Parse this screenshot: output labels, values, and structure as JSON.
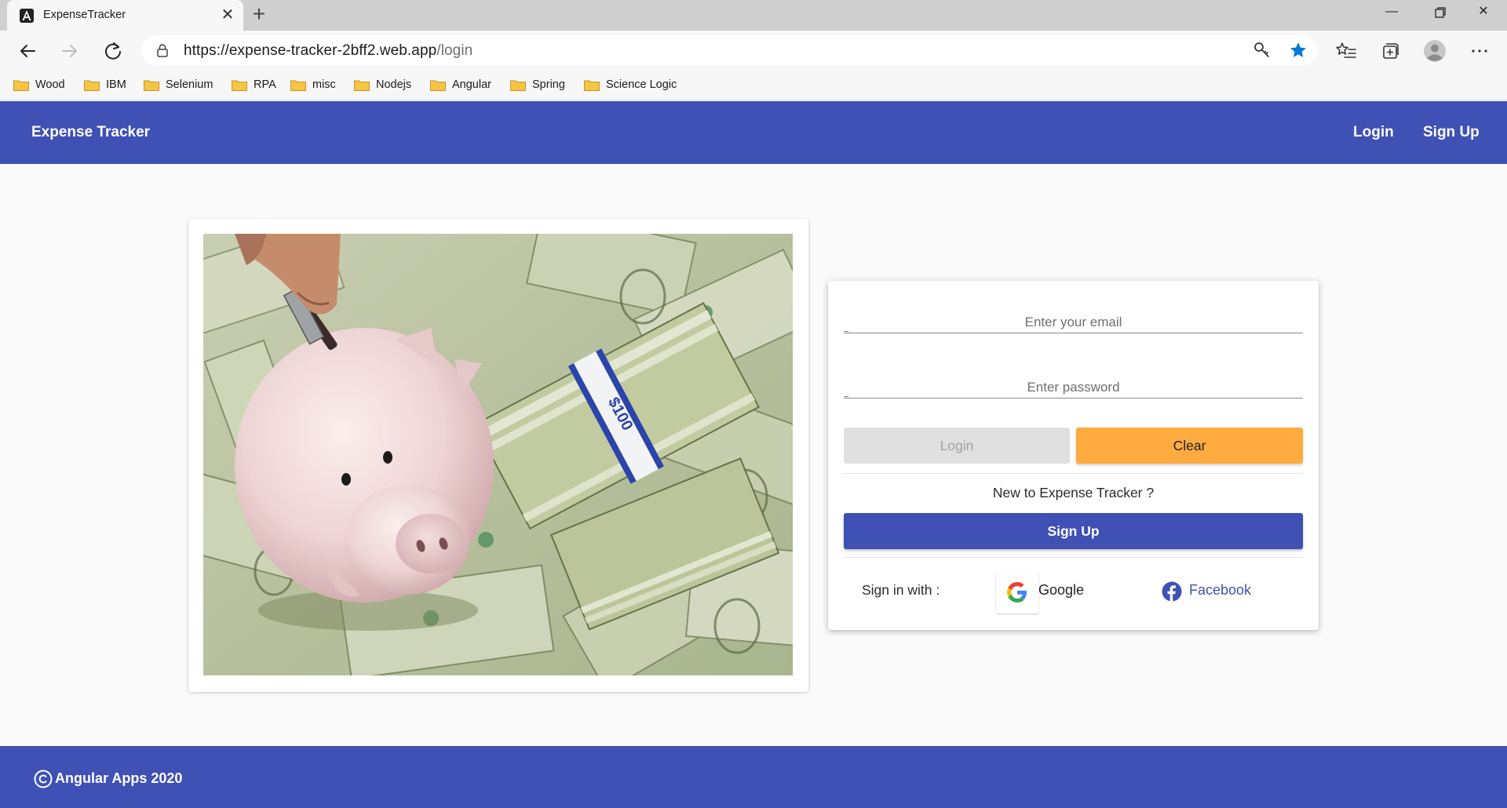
{
  "browser": {
    "tab_title": "ExpenseTracker",
    "url_base": "https://expense-tracker-2bff2.web.app",
    "url_path": "/login",
    "bookmarks": [
      {
        "label": "Wood"
      },
      {
        "label": "IBM"
      },
      {
        "label": "Selenium"
      },
      {
        "label": "RPA"
      },
      {
        "label": "misc"
      },
      {
        "label": "Nodejs"
      },
      {
        "label": "Angular"
      },
      {
        "label": "Spring"
      },
      {
        "label": "Science Logic"
      }
    ],
    "colors": {
      "folder": "#f5c543",
      "star": "#0078d4"
    }
  },
  "header": {
    "brand": "Expense Tracker",
    "login_link": "Login",
    "signup_link": "Sign Up",
    "color": "#3f51b5"
  },
  "hero": {
    "image": "piggy-bank-on-dollar-bills"
  },
  "login_form": {
    "email_placeholder": "Enter your email",
    "password_placeholder": "Enter password",
    "login_button": "Login",
    "clear_button": "Clear",
    "new_user_text": "New to Expense Tracker ?",
    "signup_button": "Sign Up",
    "sign_in_with": "Sign in with :",
    "google_label": "Google",
    "facebook_label": "Facebook",
    "colors": {
      "clear": "#ffab40",
      "primary": "#3f51b5",
      "disabled": "#e0e0e0"
    }
  },
  "footer": {
    "text": "Angular Apps 2020"
  }
}
